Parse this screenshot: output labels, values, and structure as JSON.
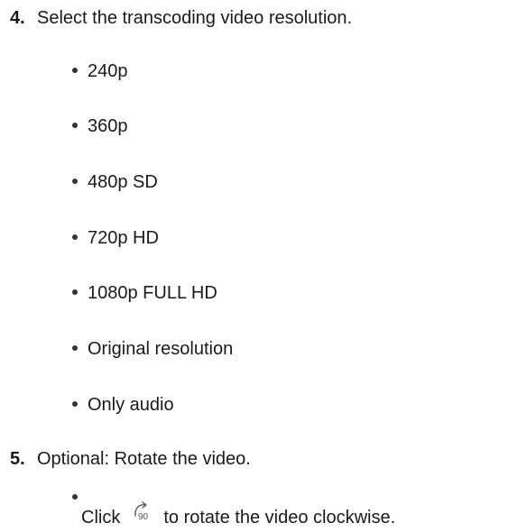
{
  "steps": [
    {
      "number": "4.",
      "text": "Select the transcoding video resolution.",
      "bullets": [
        "240p",
        "360p",
        "480p SD",
        "720p HD",
        "1080p FULL HD",
        "Original resolution",
        "Only audio"
      ]
    },
    {
      "number": "5.",
      "text": "Optional: Rotate the video.",
      "action": {
        "before": "Click",
        "icon": "rotate-clockwise-90-icon",
        "icon_label": "90",
        "after": "to rotate the video clockwise."
      }
    }
  ]
}
